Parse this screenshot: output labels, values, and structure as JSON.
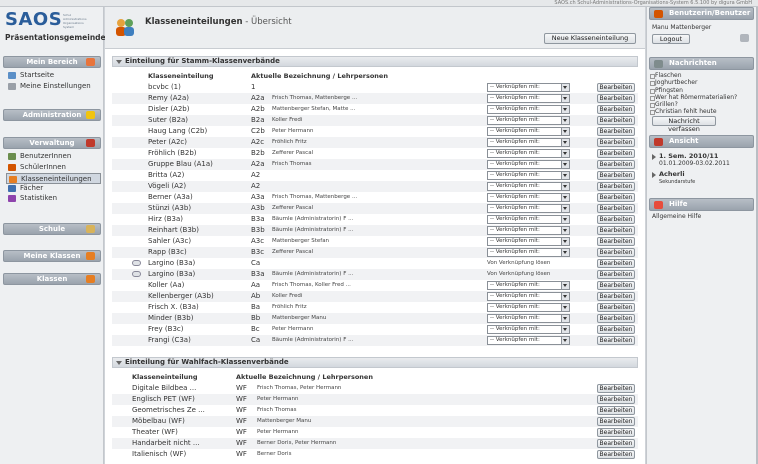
{
  "window": {
    "version": "SAOS.ch Schul-Administrations-Organisations-System 6.5.100 by digura GmbH"
  },
  "logo": {
    "word": "SAOS",
    "tagline": "Schul Administrations Organisations System",
    "school": "Präsentationsgemeinde"
  },
  "left": {
    "mein_bereich": {
      "title": "Mein Bereich",
      "items": [
        "Startseite",
        "Meine Einstellungen"
      ]
    },
    "administration": {
      "title": "Administration"
    },
    "verwaltung": {
      "title": "Verwaltung",
      "items": [
        "BenutzerInnen",
        "SchülerInnen",
        "Klasseneinteilungen",
        "Fächer",
        "Statistiken"
      ]
    },
    "schule": {
      "title": "Schule"
    },
    "meine_klassen": {
      "title": "Meine Klassen"
    },
    "klassen": {
      "title": "Klassen"
    }
  },
  "page": {
    "title": "Klasseneinteilungen",
    "subtitle": " - Übersicht",
    "new_button": "Neue Klasseneinteilung",
    "edit_label": "Bearbeiten",
    "select_placeholder": "-- Verknüpfen mit:",
    "unlink_label": "Von Verknüpfung lösen"
  },
  "stamm": {
    "title": "Einteilung für Stamm-Klassenverbände",
    "col_name": "Klasseneinteilung",
    "col_desc": "Aktuelle Bezeichnung / Lehrpersonen",
    "rows": [
      {
        "name": "bcvbc (1)",
        "code": "1",
        "persons": "",
        "linked": false
      },
      {
        "name": "Remy (A2a)",
        "code": "A2a",
        "persons": "Frisch Thomas, Mattenberge ...",
        "linked": false
      },
      {
        "name": "Disler (A2b)",
        "code": "A2b",
        "persons": "Mattenberger Stefan, Matte ...",
        "linked": false
      },
      {
        "name": "Suter (B2a)",
        "code": "B2a",
        "persons": "Koller Fredi",
        "linked": false
      },
      {
        "name": "Haug Lang (C2b)",
        "code": "C2b",
        "persons": "Peter Hermann",
        "linked": false
      },
      {
        "name": "Peter (A2c)",
        "code": "A2c",
        "persons": "Fröhlich Fritz",
        "linked": false
      },
      {
        "name": "Fröhlich (B2b)",
        "code": "B2b",
        "persons": "Zefferer Pascal",
        "linked": false
      },
      {
        "name": "Gruppe Blau (A1a)",
        "code": "A2a",
        "persons": "Frisch Thomas",
        "linked": false
      },
      {
        "name": "Britta (A2)",
        "code": "A2",
        "persons": "",
        "linked": false
      },
      {
        "name": "Vögeli (A2)",
        "code": "A2",
        "persons": "",
        "linked": false
      },
      {
        "name": "Berner (A3a)",
        "code": "A3a",
        "persons": "Frisch Thomas, Mattenberge ...",
        "linked": false
      },
      {
        "name": "Stünzi (A3b)",
        "code": "A3b",
        "persons": "Zefferer Pascal",
        "linked": false
      },
      {
        "name": "Hirz (B3a)",
        "code": "B3a",
        "persons": "Bäumle (Administratorin) F ...",
        "linked": false
      },
      {
        "name": "Reinhart (B3b)",
        "code": "B3b",
        "persons": "Bäumle (Administratorin) F ...",
        "linked": false
      },
      {
        "name": "Sahler (A3c)",
        "code": "A3c",
        "persons": "Mattenberger Stefan",
        "linked": false
      },
      {
        "name": "Rapp (B3c)",
        "code": "B3c",
        "persons": "Zefferer Pascal",
        "linked": false
      },
      {
        "name": "Largino (B3a)",
        "code": "Ca",
        "persons": "",
        "linked": true
      },
      {
        "name": "Largino (B3a)",
        "code": "B3a",
        "persons": "Bäumle (Administratorin) F ...",
        "linked": true
      },
      {
        "name": "Koller (Aa)",
        "code": "Aa",
        "persons": "Frisch Thomas, Koller Fred ...",
        "linked": false
      },
      {
        "name": "Kellenberger (A3b)",
        "code": "Ab",
        "persons": "Koller Fredi",
        "linked": false
      },
      {
        "name": "Frisch X. (B3a)",
        "code": "Ba",
        "persons": "Fröhlich Fritz",
        "linked": false
      },
      {
        "name": "Minder (B3b)",
        "code": "Bb",
        "persons": "Mattenberger Manu",
        "linked": false
      },
      {
        "name": "Frey (B3c)",
        "code": "Bc",
        "persons": "Peter Hermann",
        "linked": false
      },
      {
        "name": "Frangi (C3a)",
        "code": "Ca",
        "persons": "Bäumle (Administratorin) F ...",
        "linked": false
      }
    ]
  },
  "wahlfach": {
    "title": "Einteilung für Wahlfach-Klassenverbände",
    "col_name": "Klasseneinteilung",
    "col_desc": "Aktuelle Bezeichnung / Lehrpersonen",
    "rows": [
      {
        "name": "Digitale Bildbea ...",
        "code": "WF",
        "persons": "Frisch Thomas, Peter Hermann"
      },
      {
        "name": "Englisch PET (WF)",
        "code": "WF",
        "persons": "Peter Hermann"
      },
      {
        "name": "Geometrisches Ze ...",
        "code": "WF",
        "persons": "Frisch Thomas"
      },
      {
        "name": "Möbelbau (WF)",
        "code": "WF",
        "persons": "Mattenberger Manu"
      },
      {
        "name": "Theater (WF)",
        "code": "WF",
        "persons": "Peter Hermann"
      },
      {
        "name": "Handarbeit nicht ...",
        "code": "WF",
        "persons": "Berner Doris, Peter Hermann"
      },
      {
        "name": "Italienisch (WF)",
        "code": "WF",
        "persons": "Berner Doris"
      }
    ]
  },
  "right": {
    "user": {
      "title": "Benutzerin/Benutzer",
      "name": "Manu Mattenberger",
      "logout": "Logout"
    },
    "news": {
      "title": "Nachrichten",
      "items": [
        "Flaschen",
        "Joghurtbecher",
        "Pfingsten",
        "Wer hat Römermaterialien?",
        "Grillen?",
        "Christian fehlt heute"
      ],
      "button": "Nachricht verfassen"
    },
    "view": {
      "title": "Ansicht",
      "sem": "1. Sem. 2010/11",
      "dates": "01.01.2009-03.02.2011",
      "school": "Acherli",
      "level": "Sekundarstufe"
    },
    "help": {
      "title": "Hilfe",
      "text": "Allgemeine Hilfe"
    }
  },
  "colors": {
    "brand": "#2a5d9a",
    "header_grey": "#9aa3ad"
  }
}
